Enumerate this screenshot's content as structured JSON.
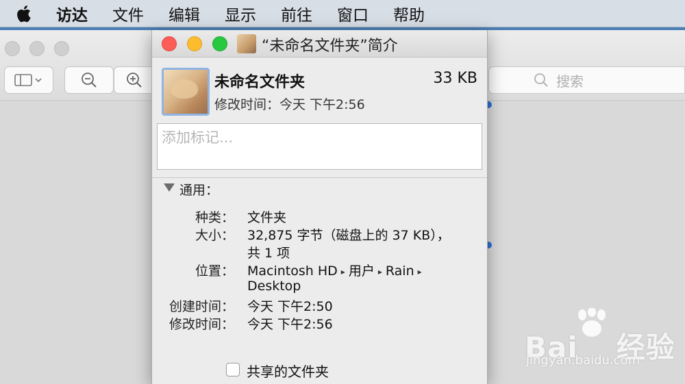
{
  "menubar": {
    "app_name": "访达",
    "items": [
      "文件",
      "编辑",
      "显示",
      "前往",
      "窗口",
      "帮助"
    ]
  },
  "finder": {
    "search_placeholder": "搜索"
  },
  "info_window": {
    "title": "“未命名文件夹”简介",
    "header": {
      "name": "未命名文件夹",
      "size": "33 KB",
      "modified": "修改时间：今天 下午2:56"
    },
    "tags_placeholder": "添加标记...",
    "general": {
      "label": "通用：",
      "kind_label": "种类：",
      "kind_value": "文件夹",
      "size_label": "大小：",
      "size_value_line1": "32,875 字节（磁盘上的 37 KB），",
      "size_value_line2": "共 1 项",
      "where_label": "位置：",
      "where_path": [
        "Macintosh HD",
        "用户",
        "Rain"
      ],
      "where_line2": "Desktop",
      "created_label": "创建时间：",
      "created_value": "今天 下午2:50",
      "modified_label": "修改时间：",
      "modified_value": "今天 下午2:56"
    },
    "shared_folder_label": "共享的文件夹"
  },
  "watermark": {
    "brand": "Bai",
    "brand_tail": "经验",
    "url": "jingyan.baidu.com"
  }
}
